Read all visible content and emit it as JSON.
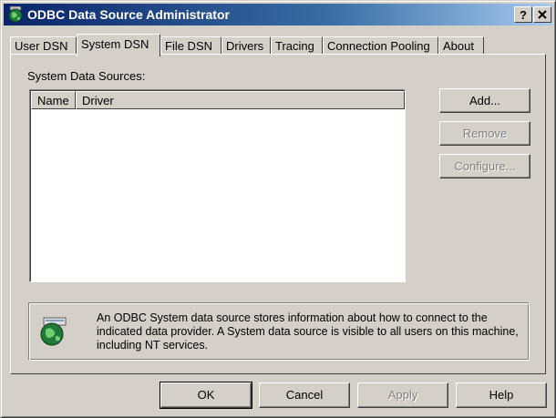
{
  "window": {
    "title": "ODBC Data Source Administrator",
    "help_button": "?",
    "close_button": "X"
  },
  "tabs": [
    {
      "label": "User DSN"
    },
    {
      "label": "System DSN"
    },
    {
      "label": "File DSN"
    },
    {
      "label": "Drivers"
    },
    {
      "label": "Tracing"
    },
    {
      "label": "Connection Pooling"
    },
    {
      "label": "About"
    }
  ],
  "active_tab": "System DSN",
  "panel": {
    "label": "System Data Sources:",
    "columns": [
      {
        "label": "Name"
      },
      {
        "label": "Driver"
      }
    ],
    "buttons": {
      "add": "Add...",
      "remove": "Remove",
      "configure": "Configure..."
    },
    "info_text": "An ODBC System data source stores information about how to connect to the indicated data provider.  A System data source is visible to all users on this machine, including NT services."
  },
  "footer": {
    "ok": "OK",
    "cancel": "Cancel",
    "apply": "Apply",
    "help": "Help"
  },
  "icons": {
    "window": "odbc-globe-icon",
    "info": "odbc-data-source-icon"
  }
}
